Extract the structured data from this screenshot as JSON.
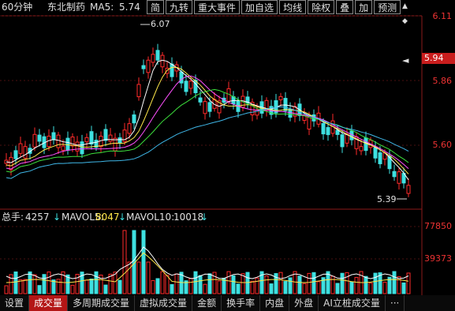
{
  "header": {
    "period": "60分钟",
    "stock_name": "东北制药",
    "ma_label": "MA5:",
    "ma_value": "5.74"
  },
  "toolbar": {
    "buttons": [
      "简",
      "九转",
      "重大事件",
      "加自选",
      "均线",
      "除权",
      "叠",
      "加",
      "预测"
    ]
  },
  "price_axis": {
    "labels": [
      "6.11",
      "5.86",
      "5.60"
    ],
    "current_price": "5.94"
  },
  "annotations": {
    "high": "6.07",
    "low": "5.39"
  },
  "volume_header": {
    "label": "总手:",
    "value": "4257",
    "mavol5_label": "MAVOL5:",
    "mavol5_value": "8047",
    "mavol10_label": "MAVOL10:",
    "mavol10_value": "10018"
  },
  "volume_axis": {
    "labels": [
      "77850",
      "39373"
    ]
  },
  "tabs": [
    "设置",
    "成交量",
    "多周期成交量",
    "虚拟成交量",
    "金额",
    "换手率",
    "内盘",
    "外盘",
    "AI立桩成交量",
    "···"
  ],
  "colors": {
    "up": "#ff2a2a",
    "down": "#3ee0e0",
    "ma5": "#ffffff",
    "ma10": "#ffe84a",
    "ma20": "#ff50ff",
    "ma30": "#3ce03c",
    "ma60": "#3fb7e8",
    "tab_active": "#b31616"
  }
}
